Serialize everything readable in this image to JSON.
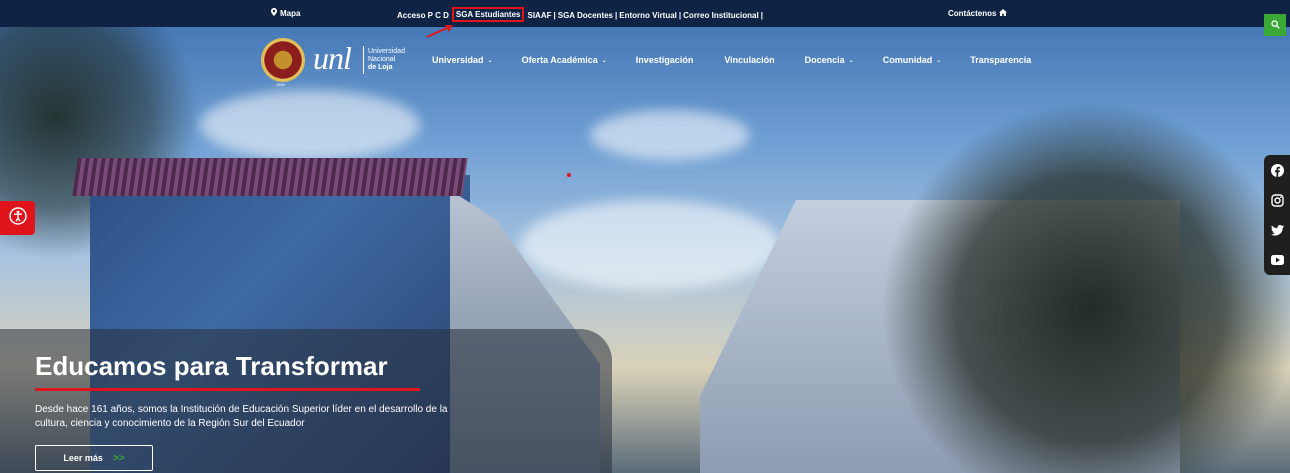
{
  "topbar": {
    "mapa": "Mapa",
    "links": [
      "Acceso P C D",
      "SGA Estudiantes",
      "SIAAF",
      "SGA Docentes",
      "Entorno Virtual",
      "Correo Institucional"
    ],
    "contact": "Contáctenos"
  },
  "logo": {
    "year": "1859",
    "unl": "unl",
    "line1": "Universidad",
    "line2": "Nacional",
    "line3": "de Loja"
  },
  "nav": {
    "items": [
      "Universidad",
      "Oferta Académica",
      "Investigación",
      "Vinculación",
      "Docencia",
      "Comunidad",
      "Transparencia"
    ]
  },
  "hero": {
    "title": "Educamos para Transformar",
    "text": "Desde hace 161 años, somos la Institución de Educación Superior líder en el desarrollo de la cultura, ciencia y conocimiento de la Región Sur del Ecuador",
    "button": "Leer más",
    "button_arrow": ">>"
  },
  "colors": {
    "navy": "#0f2345",
    "accent_red": "#e0141b",
    "green": "#3aa834"
  },
  "icons": {
    "mapa": "map-pin-icon",
    "contact": "home-icon",
    "search": "search-icon",
    "accessibility": "accessibility-icon",
    "social": [
      "facebook-icon",
      "instagram-icon",
      "twitter-icon",
      "youtube-icon"
    ]
  }
}
